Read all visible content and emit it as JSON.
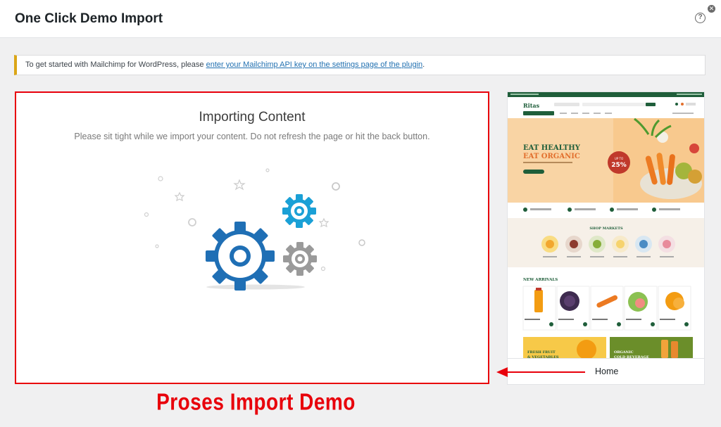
{
  "header": {
    "title": "One Click Demo Import",
    "help_icon": "help-icon",
    "close_icon": "close-icon"
  },
  "notice": {
    "text": "To get started with Mailchimp for WordPress, please ",
    "link": "enter your Mailchimp API key on the settings page of the plugin",
    "suffix": ".",
    "accent_color": "#dba617"
  },
  "import": {
    "title": "Importing Content",
    "subtitle": "Please sit tight while we import your content. Do not refresh the page or hit the back button.",
    "icon": "gears-icon",
    "border_color": "#e8000b"
  },
  "preview": {
    "footer_label": "Home",
    "site": {
      "logo": "Ritas",
      "hero_line1": "EAT HEALTHY",
      "hero_line2": "EAT ORGANIC",
      "badge_top": "UP TO",
      "badge_value": "25%",
      "hero_button": "Shop Now",
      "section_markets": "SHOP MARKETS",
      "markets": [
        "Fruits",
        "Fresh Meat",
        "Vegetables",
        "Butter & Eggs",
        "Milk & Cream",
        "Health Items"
      ],
      "section_arrivals": "NEW ARRIVALS",
      "products": [
        "Organic Juice",
        "Organic Cabbage",
        "Organic Carrot",
        "Guava Fruit",
        "Fresh Orange"
      ],
      "banner1_line1": "FRESH FRUIT",
      "banner1_line2": "& VEGETABLES",
      "banner2_line1": "ORGANIC",
      "banner2_line2": "COLD BEVERAGE"
    }
  },
  "caption": "Proses Import Demo"
}
